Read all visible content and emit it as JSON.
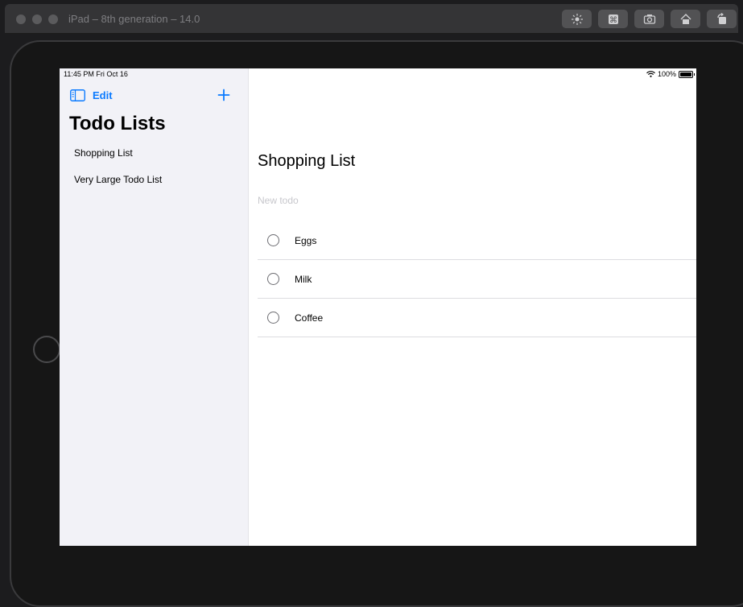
{
  "window": {
    "title": "iPad – 8th generation – 14.0",
    "toolbar": {
      "icons": [
        "brightness-icon",
        "command-icon",
        "screenshot-icon",
        "home-icon",
        "rotate-icon"
      ]
    }
  },
  "status_bar": {
    "time_date": "11:45 PM   Fri Oct 16",
    "battery": "100%"
  },
  "sidebar": {
    "edit_label": "Edit",
    "title": "Todo Lists",
    "lists": [
      {
        "label": "Shopping List"
      },
      {
        "label": "Very Large Todo List"
      }
    ]
  },
  "detail": {
    "title": "Shopping List",
    "new_todo_placeholder": "New todo",
    "todos": [
      {
        "label": "Eggs",
        "done": false
      },
      {
        "label": "Milk",
        "done": false
      },
      {
        "label": "Coffee",
        "done": false
      }
    ]
  },
  "colors": {
    "accent": "#0a7aff",
    "sidebar_bg": "#f2f2f7"
  }
}
